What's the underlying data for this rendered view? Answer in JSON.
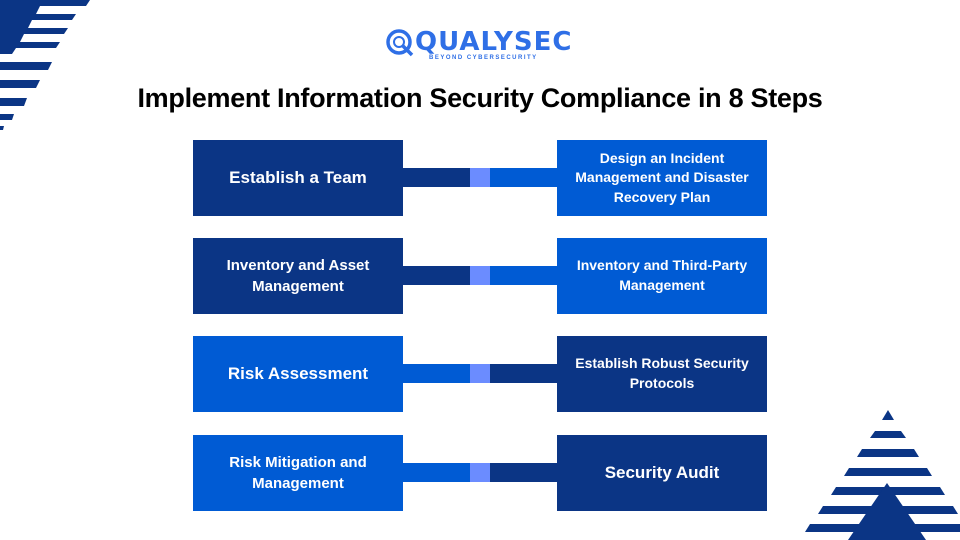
{
  "brand": {
    "name": "QUALYSEC",
    "tagline": "BEYOND CYBERSECURITY",
    "colors": {
      "dark_blue": "#0b3585",
      "bright_blue": "#005bd4",
      "connector_node": "#6b8cff",
      "logo_blue": "#2f6fe6"
    }
  },
  "title": "Implement Information Security Compliance in 8 Steps",
  "steps": [
    {
      "left": {
        "label": "Establish a Team",
        "style": "dark"
      },
      "right": {
        "label": "Design an Incident Management and Disaster Recovery Plan",
        "style": "bright"
      }
    },
    {
      "left": {
        "label": "Inventory and Asset Management",
        "style": "dark"
      },
      "right": {
        "label": "Inventory and Third-Party Management",
        "style": "bright"
      }
    },
    {
      "left": {
        "label": "Risk Assessment",
        "style": "bright"
      },
      "right": {
        "label": "Establish Robust Security Protocols",
        "style": "dark"
      }
    },
    {
      "left": {
        "label": "Risk Mitigation and Management",
        "style": "bright"
      },
      "right": {
        "label": "Security Audit",
        "style": "dark"
      }
    }
  ]
}
